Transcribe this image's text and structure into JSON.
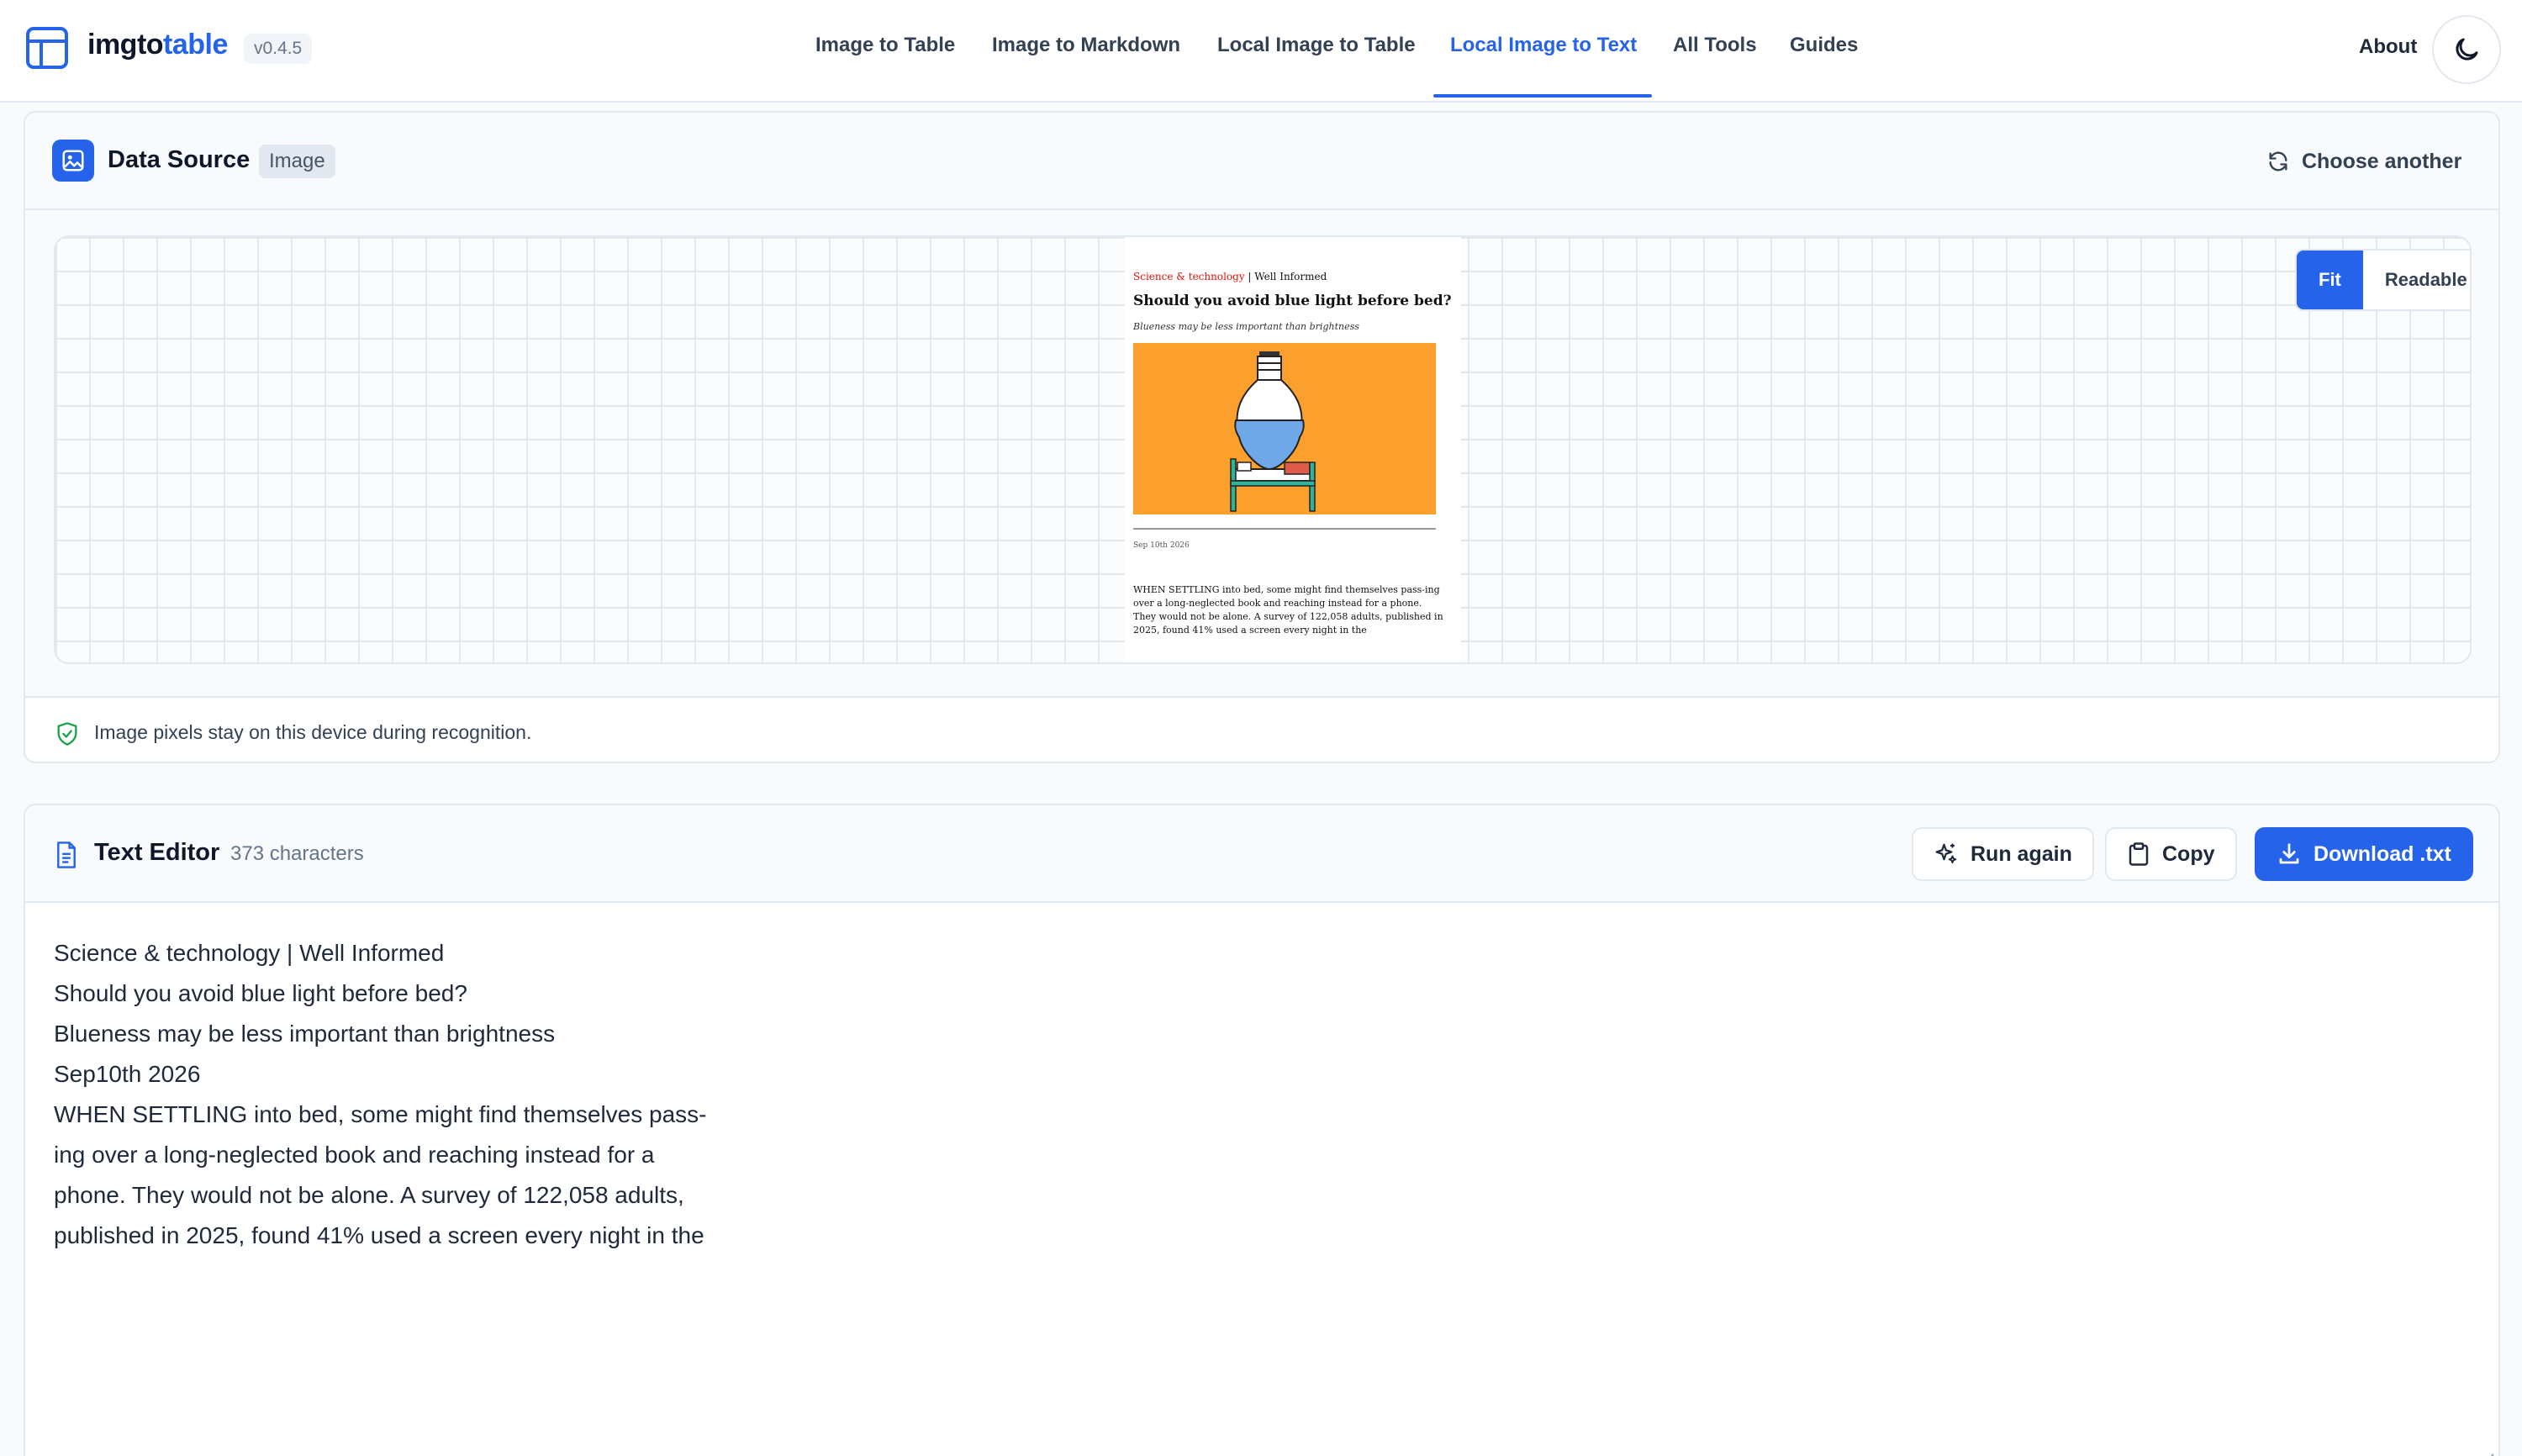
{
  "app": {
    "brand_prefix": "imgto",
    "brand_accent": "table",
    "version": "v0.4.5",
    "accent_color": "#2563eb"
  },
  "nav": {
    "items": [
      {
        "label": "Image to Table"
      },
      {
        "label": "Image to Markdown"
      },
      {
        "label": "Local Image to Table"
      },
      {
        "label": "Local Image to Text",
        "active": true
      },
      {
        "label": "All Tools"
      },
      {
        "label": "Guides"
      }
    ],
    "about": "About",
    "theme_icon": "moon-icon"
  },
  "data_source": {
    "title": "Data Source",
    "badge": "Image",
    "choose_label": "Choose another",
    "view_modes": [
      "Fit",
      "Readable"
    ],
    "active_view_mode": "Fit",
    "privacy_note": "Image pixels stay on this device during recognition.",
    "document": {
      "kicker_section": "Science & technology",
      "kicker_rest": " | Well Informed",
      "headline": "Should you avoid blue light before bed?",
      "subhead": "Blueness may be less important than brightness",
      "date": "Sep 10th 2026",
      "body": "WHEN SETTLING into bed, some might find themselves pass-ing over a long-neglected book and reaching instead for a phone. They would not be alone. A survey of 122,058 adults, published in 2025, found 41% used a screen every night in the"
    }
  },
  "text_editor": {
    "title": "Text Editor",
    "char_count": "373 characters",
    "run_again": "Run again",
    "copy": "Copy",
    "download": "Download .txt",
    "lines": [
      "Science & technology | Well Informed",
      "Should you avoid blue light before bed?",
      "Blueness may be less important than brightness",
      "Sep10th 2026",
      "WHEN SETTLING into bed, some might find themselves pass-",
      "ing over a long-neglected book and reaching instead for a",
      "phone. They would not be alone. A survey of 122,058 adults,",
      "published in 2025, found 41% used a screen every night in the"
    ]
  }
}
